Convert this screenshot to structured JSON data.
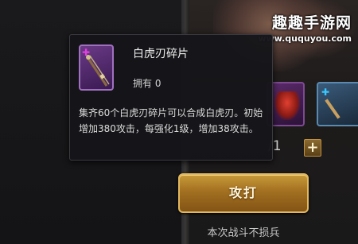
{
  "watermark": {
    "title": "趣趣手游网",
    "url": "www.ququyou.com"
  },
  "tooltip": {
    "name": "白虎刃碎片",
    "owned": "拥有 0",
    "description": "集齐60个白虎刃碎片可以合成白虎刃。初始增加380攻击，每强化1级，增加38攻击。"
  },
  "counter": {
    "text": "/1",
    "plus_label": "+"
  },
  "attack_button": {
    "label": "攻打"
  },
  "footer_note": "本次战斗不损兵",
  "icons": {
    "item": "purple-staff-fragment-icon",
    "puzzle": "puzzle-piece-icon"
  },
  "colors": {
    "tooltip_bg": "#16161a",
    "item_border": "#a070c0",
    "button_gold": "#a27020"
  }
}
